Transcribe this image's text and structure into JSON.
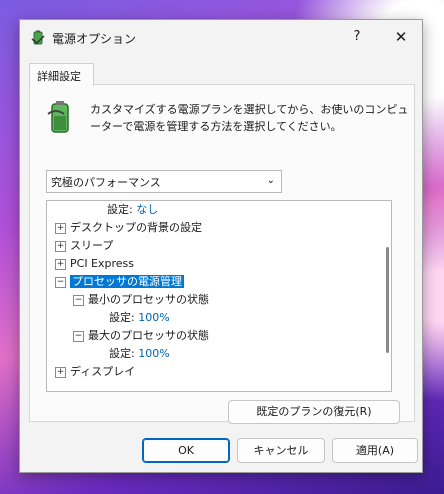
{
  "window": {
    "title": "電源オプション",
    "help_label": "?",
    "close_label": "✕"
  },
  "tabs": [
    {
      "label": "詳細設定"
    }
  ],
  "description": "カスタマイズする電源プランを選択してから、お使いのコンピューターで電源を管理する方法を選択してください。",
  "plan_select": {
    "value": "究極のパフォーマンス"
  },
  "tree": {
    "row0_label": "設定:",
    "row0_value": "なし",
    "row1_label": "デスクトップの背景の設定",
    "row2_label": "スリープ",
    "row3_label": "PCI Express",
    "row4_label": "プロセッサの電源管理",
    "row5_label": "最小のプロセッサの状態",
    "row6_label": "設定:",
    "row6_value": "100%",
    "row7_label": "最大のプロセッサの状態",
    "row8_label": "設定:",
    "row8_value": "100%",
    "row9_label": "ディスプレイ"
  },
  "buttons": {
    "restore": "既定のプランの復元(R)",
    "ok": "OK",
    "cancel": "キャンセル",
    "apply": "適用(A)"
  },
  "colors": {
    "accent": "#0078d4"
  }
}
